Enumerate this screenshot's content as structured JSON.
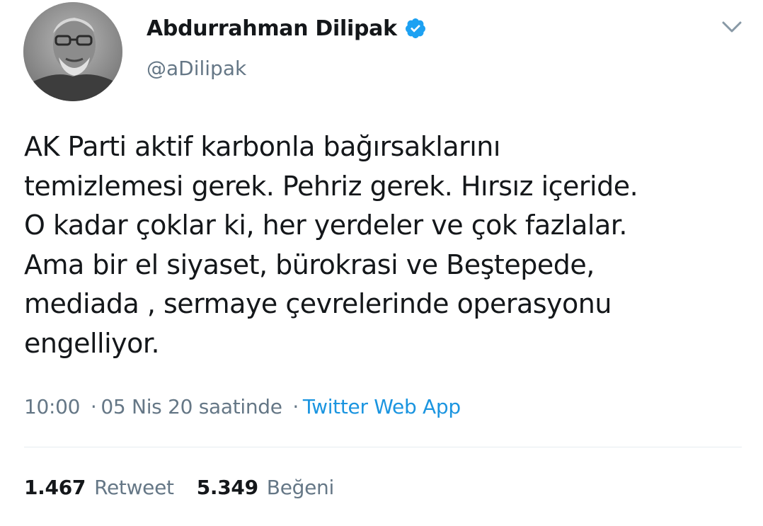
{
  "author": {
    "display_name": "Abdurrahman Dilipak",
    "handle": "@aDilipak",
    "verified": true
  },
  "tweet": {
    "text": "AK Parti aktif karbonla bağırsaklarını\ntemizlemesi gerek. Pehriz gerek. Hırsız içeride.\nO kadar çoklar ki, her yerdeler ve çok fazlalar.\nAma bir el siyaset, bürokrasi ve Beştepede,\nmediada , sermaye çevrelerinde operasyonu\nengelliyor."
  },
  "meta": {
    "time": "10:00",
    "separator": "·",
    "date": "05 Nis 20 saatinde",
    "source": "Twitter Web App"
  },
  "stats": {
    "retweet_count": "1.467",
    "retweet_label": "Retweet",
    "like_count": "5.349",
    "like_label": "Beğeni"
  },
  "colors": {
    "text": "#14171a",
    "secondary": "#657786",
    "link": "#1b95e0",
    "verified": "#1da1f2",
    "divider": "#e6ecf0"
  },
  "icons": {
    "verified": "verified-badge-icon",
    "menu": "chevron-down-icon"
  }
}
